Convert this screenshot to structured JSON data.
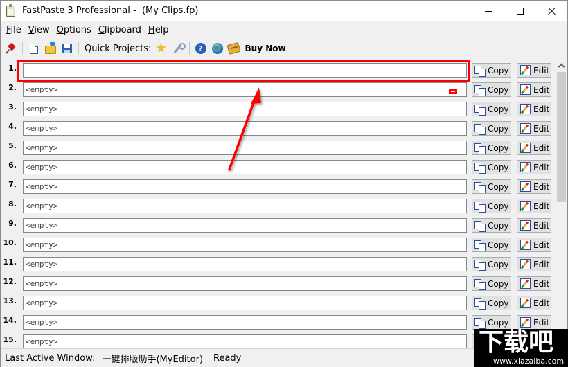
{
  "window": {
    "title": "FastPaste 3 Professional -  (My Clips.fp)",
    "controls": {
      "minimize": "minimize",
      "maximize": "maximize",
      "close": "close"
    }
  },
  "menu": {
    "items": [
      {
        "label": "File",
        "mnemonic": "F"
      },
      {
        "label": "View",
        "mnemonic": "V"
      },
      {
        "label": "Options",
        "mnemonic": "O"
      },
      {
        "label": "Clipboard",
        "mnemonic": "C"
      },
      {
        "label": "Help",
        "mnemonic": "H"
      }
    ]
  },
  "toolbar": {
    "icons": [
      "pushpin-icon",
      "new-file-icon",
      "open-folder-icon",
      "save-disk-icon",
      "star-icon",
      "wrench-icon",
      "help-icon",
      "globe-icon",
      "buy-icon"
    ],
    "quick_projects_label": "Quick Projects:",
    "buy_now_label": "Buy Now"
  },
  "clips": {
    "copy_label": "Copy",
    "edit_label": "Edit",
    "rows": [
      {
        "number": "1.",
        "value": "",
        "focused": true
      },
      {
        "number": "2.",
        "value": "<empty>"
      },
      {
        "number": "3.",
        "value": "<empty>"
      },
      {
        "number": "4.",
        "value": "<empty>"
      },
      {
        "number": "5.",
        "value": "<empty>"
      },
      {
        "number": "6.",
        "value": "<empty>"
      },
      {
        "number": "7.",
        "value": "<empty>"
      },
      {
        "number": "8.",
        "value": "<empty>"
      },
      {
        "number": "9.",
        "value": "<empty>"
      },
      {
        "number": "10.",
        "value": "<empty>"
      },
      {
        "number": "11.",
        "value": "<empty>"
      },
      {
        "number": "12.",
        "value": "<empty>"
      },
      {
        "number": "13.",
        "value": "<empty>"
      },
      {
        "number": "14.",
        "value": "<empty>"
      },
      {
        "number": "15.",
        "value": "<empty>"
      }
    ]
  },
  "annotation": {
    "color": "#ff0000",
    "target": "clip 1 input field"
  },
  "statusbar": {
    "last_active_label": "Last Active Window:",
    "last_active_value": "一键排版助手(MyEditor)",
    "status": "Ready"
  },
  "watermark": {
    "logo_text": "下载吧",
    "url": "www.xiazaiba.com"
  },
  "colors": {
    "highlight": "#ff0000",
    "window_bg": "#f0f0f0",
    "field_border": "#828790",
    "button_bg": "#e1e1e1"
  }
}
